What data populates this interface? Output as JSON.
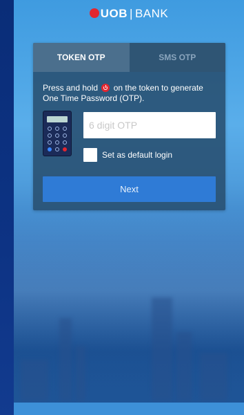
{
  "brand": {
    "name": "UOB",
    "suffix": "BANK"
  },
  "tabs": [
    {
      "label": "TOKEN OTP",
      "active": true
    },
    {
      "label": "SMS OTP",
      "active": false
    }
  ],
  "instructions": {
    "before_icon": "Press and hold",
    "after_icon": "on the token to generate One Time Password (OTP).",
    "icon": "power-icon"
  },
  "otp_field": {
    "placeholder": "6 digit OTP",
    "value": ""
  },
  "default_login": {
    "label": "Set as default login",
    "checked": false
  },
  "next_button": {
    "label": "Next"
  },
  "colors": {
    "brand_red": "#e3262f",
    "primary_button": "#2f7bd6",
    "card_background": "#284e70"
  }
}
